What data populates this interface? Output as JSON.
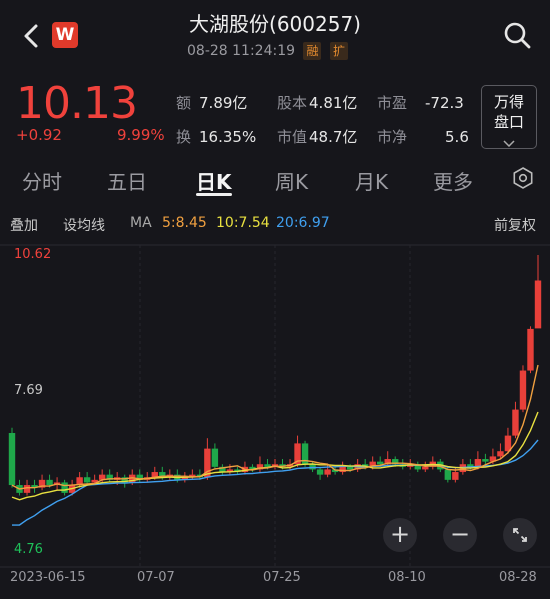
{
  "header": {
    "title": "大湖股份(600257)",
    "datetime": "08-28 11:24:19",
    "tags": [
      "融",
      "扩"
    ],
    "logo_letter": "W"
  },
  "quote": {
    "price": "10.13",
    "change": "+0.92",
    "change_pct": "9.99%",
    "stats": [
      {
        "label": "额",
        "value": "7.89亿"
      },
      {
        "label": "股本",
        "value": "4.81亿"
      },
      {
        "label": "市盈",
        "value": "-72.3"
      },
      {
        "label": "换",
        "value": "16.35%"
      },
      {
        "label": "市值",
        "value": "48.7亿"
      },
      {
        "label": "市净",
        "value": "5.6"
      }
    ],
    "side_button": [
      "万得",
      "盘口"
    ]
  },
  "tabs": [
    "分时",
    "五日",
    "日K",
    "周K",
    "月K",
    "更多"
  ],
  "active_tab": "日K",
  "indicators": {
    "overlay": "叠加",
    "set_ma": "设均线",
    "ma": "MA",
    "ma5": "5:8.45",
    "ma10": "10:7.54",
    "ma20": "20:6.97",
    "adjust": "前复权",
    "colors": {
      "ma5": "#f0a040",
      "ma10": "#e8e040",
      "ma20": "#40a0f0"
    }
  },
  "chart": {
    "ymax": "10.62",
    "ymid": "7.69",
    "ymin": "4.76",
    "xlabels": [
      "2023-06-15",
      "07-07",
      "07-25",
      "08-10",
      "08-28"
    ],
    "zoom_in": "+",
    "zoom_out": "−",
    "colors": {
      "up": "#e8403a",
      "down": "#1fa84a"
    }
  },
  "chart_data": {
    "type": "candlestick",
    "ylim": [
      4.76,
      10.62
    ],
    "x": [
      "2023-06-15",
      "07-07",
      "07-25",
      "08-10",
      "08-28"
    ],
    "candles": [
      [
        7.2,
        6.2,
        7.3,
        6.15
      ],
      [
        6.2,
        6.05,
        6.3,
        6.0
      ],
      [
        6.05,
        6.2,
        6.3,
        6.0
      ],
      [
        6.2,
        6.15,
        6.3,
        6.05
      ],
      [
        6.15,
        6.3,
        6.4,
        6.1
      ],
      [
        6.3,
        6.2,
        6.4,
        6.15
      ],
      [
        6.2,
        6.25,
        6.35,
        6.1
      ],
      [
        6.25,
        6.05,
        6.3,
        6.0
      ],
      [
        6.05,
        6.2,
        6.3,
        6.0
      ],
      [
        6.2,
        6.35,
        6.45,
        6.15
      ],
      [
        6.35,
        6.25,
        6.45,
        6.2
      ],
      [
        6.25,
        6.3,
        6.4,
        6.2
      ],
      [
        6.3,
        6.4,
        6.5,
        6.25
      ],
      [
        6.4,
        6.3,
        6.5,
        6.25
      ],
      [
        6.3,
        6.35,
        6.45,
        6.2
      ],
      [
        6.35,
        6.25,
        6.4,
        6.15
      ],
      [
        6.25,
        6.4,
        6.5,
        6.2
      ],
      [
        6.4,
        6.3,
        6.5,
        6.25
      ],
      [
        6.3,
        6.35,
        6.45,
        6.25
      ],
      [
        6.35,
        6.45,
        6.55,
        6.3
      ],
      [
        6.45,
        6.35,
        6.55,
        6.3
      ],
      [
        6.35,
        6.4,
        6.5,
        6.3
      ],
      [
        6.4,
        6.3,
        6.5,
        6.25
      ],
      [
        6.3,
        6.35,
        6.45,
        6.25
      ],
      [
        6.35,
        6.4,
        6.5,
        6.3
      ],
      [
        6.4,
        6.35,
        6.5,
        6.3
      ],
      [
        6.35,
        6.9,
        7.1,
        6.3
      ],
      [
        6.9,
        6.55,
        7.0,
        6.5
      ],
      [
        6.55,
        6.45,
        6.6,
        6.4
      ],
      [
        6.45,
        6.5,
        6.6,
        6.4
      ],
      [
        6.5,
        6.45,
        6.55,
        6.4
      ],
      [
        6.45,
        6.55,
        6.65,
        6.4
      ],
      [
        6.55,
        6.5,
        6.6,
        6.45
      ],
      [
        6.5,
        6.6,
        6.75,
        6.45
      ],
      [
        6.6,
        6.55,
        6.7,
        6.5
      ],
      [
        6.55,
        6.6,
        6.7,
        6.5
      ],
      [
        6.6,
        6.55,
        6.7,
        6.5
      ],
      [
        6.55,
        6.6,
        6.7,
        6.5
      ],
      [
        6.6,
        7.0,
        7.15,
        6.55
      ],
      [
        7.0,
        6.6,
        7.05,
        6.55
      ],
      [
        6.6,
        6.5,
        6.65,
        6.45
      ],
      [
        6.5,
        6.4,
        6.55,
        6.3
      ],
      [
        6.4,
        6.5,
        6.6,
        6.35
      ],
      [
        6.5,
        6.45,
        6.55,
        6.4
      ],
      [
        6.45,
        6.55,
        6.65,
        6.4
      ],
      [
        6.55,
        6.5,
        6.6,
        6.45
      ],
      [
        6.5,
        6.6,
        6.7,
        6.45
      ],
      [
        6.6,
        6.55,
        6.7,
        6.5
      ],
      [
        6.55,
        6.65,
        6.75,
        6.5
      ],
      [
        6.65,
        6.6,
        6.75,
        6.55
      ],
      [
        6.6,
        6.7,
        6.85,
        6.55
      ],
      [
        6.7,
        6.6,
        6.75,
        6.55
      ],
      [
        6.6,
        6.55,
        6.7,
        6.5
      ],
      [
        6.55,
        6.6,
        6.7,
        6.5
      ],
      [
        6.6,
        6.5,
        6.65,
        6.45
      ],
      [
        6.5,
        6.55,
        6.65,
        6.45
      ],
      [
        6.55,
        6.65,
        6.75,
        6.5
      ],
      [
        6.65,
        6.5,
        6.7,
        6.45
      ],
      [
        6.5,
        6.3,
        6.55,
        6.25
      ],
      [
        6.3,
        6.45,
        6.55,
        6.25
      ],
      [
        6.45,
        6.6,
        6.7,
        6.4
      ],
      [
        6.6,
        6.55,
        6.7,
        6.5
      ],
      [
        6.55,
        6.7,
        6.85,
        6.5
      ],
      [
        6.7,
        6.65,
        6.8,
        6.6
      ],
      [
        6.65,
        6.75,
        6.9,
        6.6
      ],
      [
        6.75,
        6.85,
        7.0,
        6.7
      ],
      [
        6.85,
        7.15,
        7.3,
        6.8
      ],
      [
        7.15,
        7.65,
        7.8,
        7.1
      ],
      [
        7.65,
        8.4,
        8.5,
        7.6
      ],
      [
        8.4,
        9.2,
        9.25,
        8.35
      ],
      [
        9.21,
        10.13,
        10.62,
        9.9
      ]
    ],
    "ma5_last": 8.45,
    "ma10_last": 7.54,
    "ma20_last": 6.97
  }
}
